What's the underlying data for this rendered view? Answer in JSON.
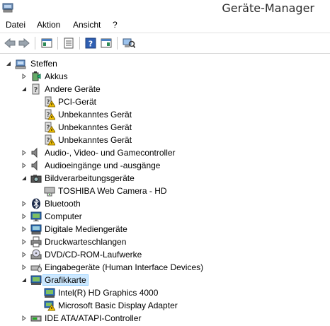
{
  "window": {
    "title": "Geräte-Manager"
  },
  "menu": {
    "items": [
      "Datei",
      "Aktion",
      "Ansicht",
      "?"
    ]
  },
  "toolbar": {
    "buttons": [
      "back-icon",
      "forward-icon",
      "show-hide-console-tree-icon",
      "properties-icon",
      "help-icon",
      "console-view-icon",
      "scan-hardware-icon"
    ]
  },
  "tree": {
    "root": {
      "label": "Steffen",
      "icon": "computer-icon",
      "expanded": true
    },
    "nodes": [
      {
        "label": "Akkus",
        "icon": "battery-icon",
        "level": 1,
        "expandable": true,
        "expanded": false
      },
      {
        "label": "Andere Geräte",
        "icon": "other-devices-icon",
        "level": 1,
        "expandable": true,
        "expanded": true
      },
      {
        "label": "PCI-Gerät",
        "icon": "unknown-device-warning-icon",
        "level": 2,
        "expandable": false
      },
      {
        "label": "Unbekanntes Gerät",
        "icon": "unknown-device-warning-icon",
        "level": 2,
        "expandable": false
      },
      {
        "label": "Unbekanntes Gerät",
        "icon": "unknown-device-warning-icon",
        "level": 2,
        "expandable": false
      },
      {
        "label": "Unbekanntes Gerät",
        "icon": "unknown-device-warning-icon",
        "level": 2,
        "expandable": false
      },
      {
        "label": "Audio-, Video- und Gamecontroller",
        "icon": "speaker-icon",
        "level": 1,
        "expandable": true,
        "expanded": false
      },
      {
        "label": "Audioeingänge und -ausgänge",
        "icon": "speaker-icon",
        "level": 1,
        "expandable": true,
        "expanded": false
      },
      {
        "label": "Bildverarbeitungsgeräte",
        "icon": "camera-icon",
        "level": 1,
        "expandable": true,
        "expanded": true
      },
      {
        "label": "TOSHIBA Web Camera - HD",
        "icon": "webcam-icon",
        "level": 2,
        "expandable": false
      },
      {
        "label": "Bluetooth",
        "icon": "bluetooth-icon",
        "level": 1,
        "expandable": true,
        "expanded": false
      },
      {
        "label": "Computer",
        "icon": "monitor-icon",
        "level": 1,
        "expandable": true,
        "expanded": false
      },
      {
        "label": "Digitale Mediengeräte",
        "icon": "media-device-icon",
        "level": 1,
        "expandable": true,
        "expanded": false
      },
      {
        "label": "Druckwarteschlangen",
        "icon": "printer-icon",
        "level": 1,
        "expandable": true,
        "expanded": false
      },
      {
        "label": "DVD/CD-ROM-Laufwerke",
        "icon": "disc-drive-icon",
        "level": 1,
        "expandable": true,
        "expanded": false
      },
      {
        "label": "Eingabegeräte (Human Interface Devices)",
        "icon": "hid-icon",
        "level": 1,
        "expandable": true,
        "expanded": false
      },
      {
        "label": "Grafikkarte",
        "icon": "display-adapter-icon",
        "level": 1,
        "expandable": true,
        "expanded": true,
        "selected": true
      },
      {
        "label": "Intel(R) HD Graphics 4000",
        "icon": "display-adapter-icon",
        "level": 2,
        "expandable": false
      },
      {
        "label": "Microsoft Basic Display Adapter",
        "icon": "display-adapter-warning-icon",
        "level": 2,
        "expandable": false
      },
      {
        "label": "IDE ATA/ATAPI-Controller",
        "icon": "ide-controller-icon",
        "level": 1,
        "expandable": true,
        "expanded": false
      }
    ]
  },
  "colors": {
    "selection_bg": "#cce8ff",
    "selection_border": "#99d1ff",
    "warning": "#f5c400"
  }
}
